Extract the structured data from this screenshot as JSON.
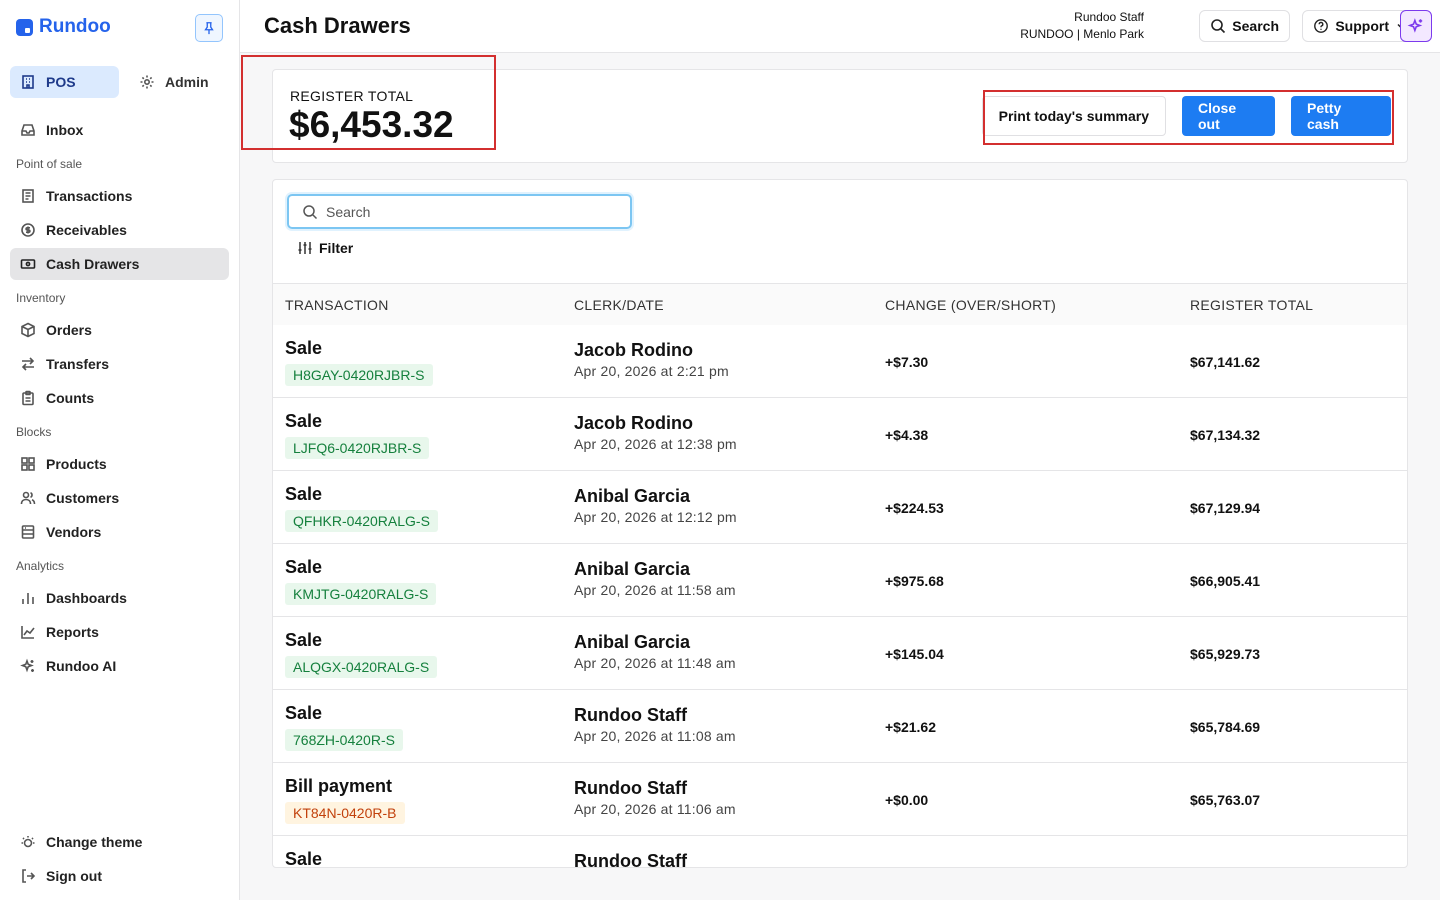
{
  "brand": {
    "name": "Rundoo"
  },
  "sidebar": {
    "modes": [
      {
        "label": "POS",
        "icon": "building-icon",
        "active": true
      },
      {
        "label": "Admin",
        "icon": "gear-icon",
        "active": false
      }
    ],
    "inbox": {
      "label": "Inbox",
      "icon": "inbox-icon"
    },
    "sections": [
      {
        "title": "Point of sale",
        "items": [
          {
            "label": "Transactions",
            "icon": "document-icon"
          },
          {
            "label": "Receivables",
            "icon": "dollar-circle-icon"
          },
          {
            "label": "Cash Drawers",
            "icon": "cash-icon",
            "active": true
          }
        ]
      },
      {
        "title": "Inventory",
        "items": [
          {
            "label": "Orders",
            "icon": "box-icon"
          },
          {
            "label": "Transfers",
            "icon": "arrows-icon"
          },
          {
            "label": "Counts",
            "icon": "clipboard-icon"
          }
        ]
      },
      {
        "title": "Blocks",
        "items": [
          {
            "label": "Products",
            "icon": "grid-icon"
          },
          {
            "label": "Customers",
            "icon": "users-icon"
          },
          {
            "label": "Vendors",
            "icon": "store-icon"
          }
        ]
      },
      {
        "title": "Analytics",
        "items": [
          {
            "label": "Dashboards",
            "icon": "bar-chart-icon"
          },
          {
            "label": "Reports",
            "icon": "line-chart-icon"
          },
          {
            "label": "Rundoo AI",
            "icon": "sparkle-icon"
          }
        ]
      }
    ],
    "bottom": [
      {
        "label": "Change theme",
        "icon": "theme-icon"
      },
      {
        "label": "Sign out",
        "icon": "sign-out-icon"
      }
    ]
  },
  "header": {
    "title": "Cash Drawers",
    "user_name": "Rundoo Staff",
    "store": "RUNDOO | Menlo Park",
    "search_label": "Search",
    "support_label": "Support"
  },
  "summary": {
    "label": "REGISTER TOTAL",
    "value": "$6,453.32",
    "print_label": "Print today's summary",
    "close_out_label": "Close out",
    "petty_cash_label": "Petty cash"
  },
  "table": {
    "search_placeholder": "Search",
    "filter_label": "Filter",
    "columns": [
      "TRANSACTION",
      "CLERK/DATE",
      "CHANGE (OVER/SHORT)",
      "REGISTER TOTAL"
    ],
    "rows": [
      {
        "type": "Sale",
        "id": "H8GAY-0420RJBR-S",
        "tag": "green",
        "clerk": "Jacob Rodino",
        "date": "Apr 20, 2026 at 2:21 pm",
        "change": "+$7.30",
        "total": "$67,141.62"
      },
      {
        "type": "Sale",
        "id": "LJFQ6-0420RJBR-S",
        "tag": "green",
        "clerk": "Jacob Rodino",
        "date": "Apr 20, 2026 at 12:38 pm",
        "change": "+$4.38",
        "total": "$67,134.32"
      },
      {
        "type": "Sale",
        "id": "QFHKR-0420RALG-S",
        "tag": "green",
        "clerk": "Anibal Garcia",
        "date": "Apr 20, 2026 at 12:12 pm",
        "change": "+$224.53",
        "total": "$67,129.94"
      },
      {
        "type": "Sale",
        "id": "KMJTG-0420RALG-S",
        "tag": "green",
        "clerk": "Anibal Garcia",
        "date": "Apr 20, 2026 at 11:58 am",
        "change": "+$975.68",
        "total": "$66,905.41"
      },
      {
        "type": "Sale",
        "id": "ALQGX-0420RALG-S",
        "tag": "green",
        "clerk": "Anibal Garcia",
        "date": "Apr 20, 2026 at 11:48 am",
        "change": "+$145.04",
        "total": "$65,929.73"
      },
      {
        "type": "Sale",
        "id": "768ZH-0420R-S",
        "tag": "green",
        "clerk": "Rundoo Staff",
        "date": "Apr 20, 2026 at 11:08 am",
        "change": "+$21.62",
        "total": "$65,784.69"
      },
      {
        "type": "Bill payment",
        "id": "KT84N-0420R-B",
        "tag": "orange",
        "clerk": "Rundoo Staff",
        "date": "Apr 20, 2026 at 11:06 am",
        "change": "+$0.00",
        "total": "$65,763.07"
      },
      {
        "type": "Sale",
        "id": "",
        "tag": "green",
        "clerk": "Rundoo Staff",
        "date": "",
        "change": "",
        "total": ""
      }
    ]
  },
  "colors": {
    "accent": "#1d7cf2",
    "brand": "#2563eb",
    "highlight": "#d32f2f",
    "ai": "#7c3aed"
  }
}
